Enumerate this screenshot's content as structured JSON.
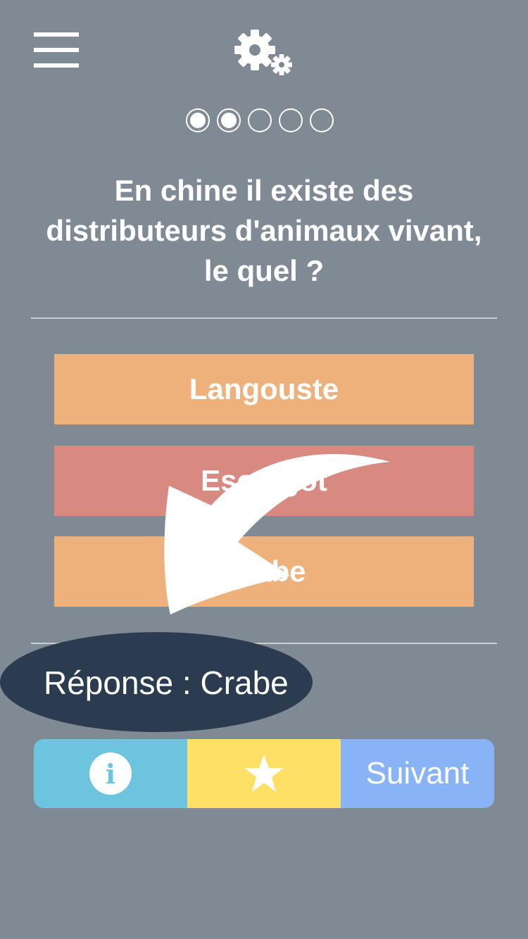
{
  "header": {
    "menu_icon": "hamburger-menu-icon",
    "settings_icon": "gears-icon"
  },
  "progress": {
    "total": 5,
    "completed": 2
  },
  "question": {
    "text": "En chine il existe des distributeurs d'animaux vivant, le quel ?"
  },
  "answers": [
    {
      "label": "Langouste",
      "color": "#efb17c"
    },
    {
      "label": "Escargot",
      "color": "#d88980"
    },
    {
      "label": "Crabe",
      "color": "#efb17c"
    }
  ],
  "result": {
    "text": "Réponse : Crabe"
  },
  "toolbar": {
    "info_icon": "info-icon",
    "info_glyph": "i",
    "favorite_icon": "star-icon",
    "next_label": "Suivant"
  },
  "colors": {
    "background": "#808a95",
    "info": "#6cc4de",
    "favorite": "#fee066",
    "next": "#88b3f7",
    "result_badge": "#2c3c50"
  }
}
